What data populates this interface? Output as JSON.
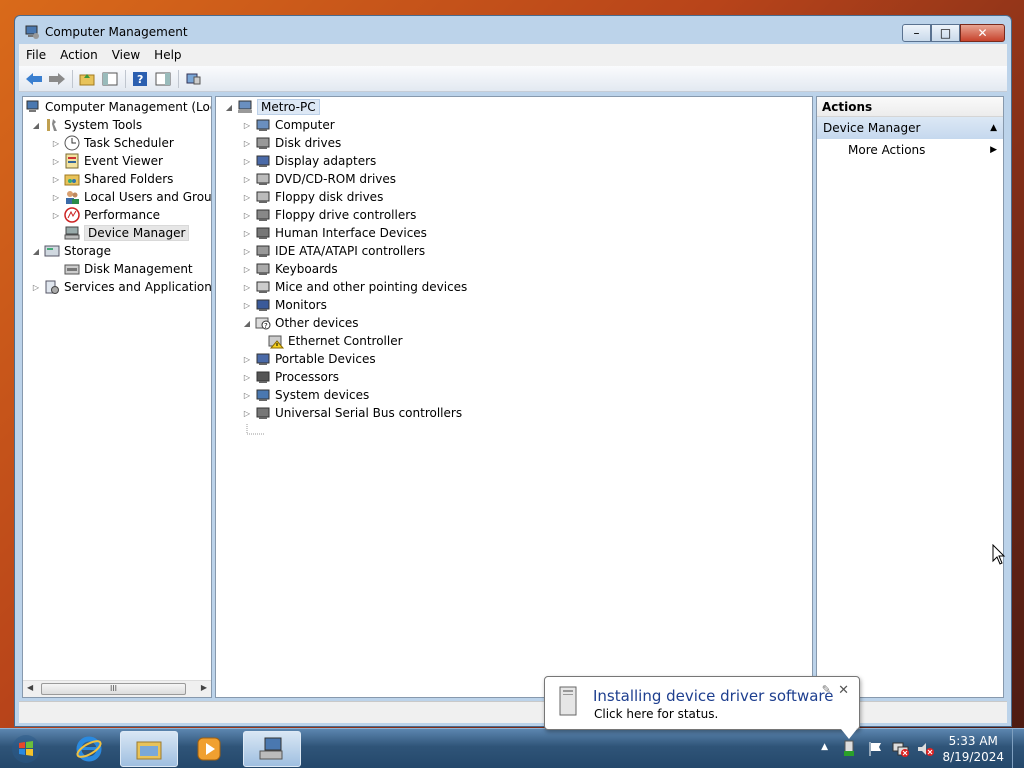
{
  "window": {
    "title": "Computer Management",
    "controls": {
      "minimize": "–",
      "maximize": "□",
      "close": "✕"
    }
  },
  "menu": [
    "File",
    "Action",
    "View",
    "Help"
  ],
  "toolbar": {
    "icons": [
      "back-arrow-icon",
      "forward-arrow-icon",
      "up-folder-icon",
      "show-hide-console-tree-icon",
      "help-icon",
      "show-hide-action-pane-icon",
      "properties-icon"
    ]
  },
  "left_tree": {
    "root": "Computer Management (Local",
    "items": [
      {
        "label": "System Tools",
        "icon": "tools-icon"
      },
      {
        "label": "Task Scheduler",
        "icon": "clock-icon"
      },
      {
        "label": "Event Viewer",
        "icon": "event-viewer-icon"
      },
      {
        "label": "Shared Folders",
        "icon": "shared-folder-icon"
      },
      {
        "label": "Local Users and Groups",
        "icon": "users-icon"
      },
      {
        "label": "Performance",
        "icon": "performance-icon"
      },
      {
        "label": "Device Manager",
        "icon": "device-manager-icon"
      },
      {
        "label": "Storage",
        "icon": "storage-icon"
      },
      {
        "label": "Disk Management",
        "icon": "disk-icon"
      },
      {
        "label": "Services and Applications",
        "icon": "services-icon"
      }
    ],
    "scroll_thumb": "III"
  },
  "device_tree": {
    "root": "Metro-PC",
    "items": [
      "Computer",
      "Disk drives",
      "Display adapters",
      "DVD/CD-ROM drives",
      "Floppy disk drives",
      "Floppy drive controllers",
      "Human Interface Devices",
      "IDE ATA/ATAPI controllers",
      "Keyboards",
      "Mice and other pointing devices",
      "Monitors",
      "Other devices",
      "Ethernet Controller",
      "Portable Devices",
      "Processors",
      "System devices",
      "Universal Serial Bus controllers"
    ]
  },
  "actions": {
    "header": "Actions",
    "section": "Device Manager",
    "more": "More Actions"
  },
  "balloon": {
    "title": "Installing device driver software",
    "text": "Click here for status."
  },
  "clock": {
    "time": "5:33 AM",
    "date": "8/19/2024"
  }
}
